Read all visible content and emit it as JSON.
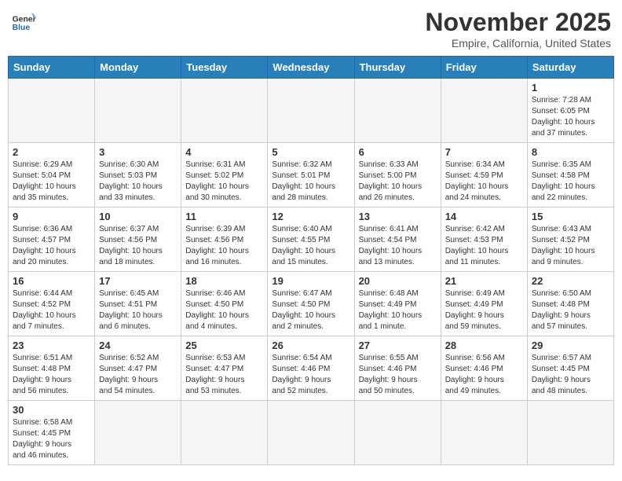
{
  "header": {
    "logo_general": "General",
    "logo_blue": "Blue",
    "month": "November 2025",
    "location": "Empire, California, United States"
  },
  "weekdays": [
    "Sunday",
    "Monday",
    "Tuesday",
    "Wednesday",
    "Thursday",
    "Friday",
    "Saturday"
  ],
  "weeks": [
    [
      {
        "day": "",
        "info": ""
      },
      {
        "day": "",
        "info": ""
      },
      {
        "day": "",
        "info": ""
      },
      {
        "day": "",
        "info": ""
      },
      {
        "day": "",
        "info": ""
      },
      {
        "day": "",
        "info": ""
      },
      {
        "day": "1",
        "info": "Sunrise: 7:28 AM\nSunset: 6:05 PM\nDaylight: 10 hours\nand 37 minutes."
      }
    ],
    [
      {
        "day": "2",
        "info": "Sunrise: 6:29 AM\nSunset: 5:04 PM\nDaylight: 10 hours\nand 35 minutes."
      },
      {
        "day": "3",
        "info": "Sunrise: 6:30 AM\nSunset: 5:03 PM\nDaylight: 10 hours\nand 33 minutes."
      },
      {
        "day": "4",
        "info": "Sunrise: 6:31 AM\nSunset: 5:02 PM\nDaylight: 10 hours\nand 30 minutes."
      },
      {
        "day": "5",
        "info": "Sunrise: 6:32 AM\nSunset: 5:01 PM\nDaylight: 10 hours\nand 28 minutes."
      },
      {
        "day": "6",
        "info": "Sunrise: 6:33 AM\nSunset: 5:00 PM\nDaylight: 10 hours\nand 26 minutes."
      },
      {
        "day": "7",
        "info": "Sunrise: 6:34 AM\nSunset: 4:59 PM\nDaylight: 10 hours\nand 24 minutes."
      },
      {
        "day": "8",
        "info": "Sunrise: 6:35 AM\nSunset: 4:58 PM\nDaylight: 10 hours\nand 22 minutes."
      }
    ],
    [
      {
        "day": "9",
        "info": "Sunrise: 6:36 AM\nSunset: 4:57 PM\nDaylight: 10 hours\nand 20 minutes."
      },
      {
        "day": "10",
        "info": "Sunrise: 6:37 AM\nSunset: 4:56 PM\nDaylight: 10 hours\nand 18 minutes."
      },
      {
        "day": "11",
        "info": "Sunrise: 6:39 AM\nSunset: 4:56 PM\nDaylight: 10 hours\nand 16 minutes."
      },
      {
        "day": "12",
        "info": "Sunrise: 6:40 AM\nSunset: 4:55 PM\nDaylight: 10 hours\nand 15 minutes."
      },
      {
        "day": "13",
        "info": "Sunrise: 6:41 AM\nSunset: 4:54 PM\nDaylight: 10 hours\nand 13 minutes."
      },
      {
        "day": "14",
        "info": "Sunrise: 6:42 AM\nSunset: 4:53 PM\nDaylight: 10 hours\nand 11 minutes."
      },
      {
        "day": "15",
        "info": "Sunrise: 6:43 AM\nSunset: 4:52 PM\nDaylight: 10 hours\nand 9 minutes."
      }
    ],
    [
      {
        "day": "16",
        "info": "Sunrise: 6:44 AM\nSunset: 4:52 PM\nDaylight: 10 hours\nand 7 minutes."
      },
      {
        "day": "17",
        "info": "Sunrise: 6:45 AM\nSunset: 4:51 PM\nDaylight: 10 hours\nand 6 minutes."
      },
      {
        "day": "18",
        "info": "Sunrise: 6:46 AM\nSunset: 4:50 PM\nDaylight: 10 hours\nand 4 minutes."
      },
      {
        "day": "19",
        "info": "Sunrise: 6:47 AM\nSunset: 4:50 PM\nDaylight: 10 hours\nand 2 minutes."
      },
      {
        "day": "20",
        "info": "Sunrise: 6:48 AM\nSunset: 4:49 PM\nDaylight: 10 hours\nand 1 minute."
      },
      {
        "day": "21",
        "info": "Sunrise: 6:49 AM\nSunset: 4:49 PM\nDaylight: 9 hours\nand 59 minutes."
      },
      {
        "day": "22",
        "info": "Sunrise: 6:50 AM\nSunset: 4:48 PM\nDaylight: 9 hours\nand 57 minutes."
      }
    ],
    [
      {
        "day": "23",
        "info": "Sunrise: 6:51 AM\nSunset: 4:48 PM\nDaylight: 9 hours\nand 56 minutes."
      },
      {
        "day": "24",
        "info": "Sunrise: 6:52 AM\nSunset: 4:47 PM\nDaylight: 9 hours\nand 54 minutes."
      },
      {
        "day": "25",
        "info": "Sunrise: 6:53 AM\nSunset: 4:47 PM\nDaylight: 9 hours\nand 53 minutes."
      },
      {
        "day": "26",
        "info": "Sunrise: 6:54 AM\nSunset: 4:46 PM\nDaylight: 9 hours\nand 52 minutes."
      },
      {
        "day": "27",
        "info": "Sunrise: 6:55 AM\nSunset: 4:46 PM\nDaylight: 9 hours\nand 50 minutes."
      },
      {
        "day": "28",
        "info": "Sunrise: 6:56 AM\nSunset: 4:46 PM\nDaylight: 9 hours\nand 49 minutes."
      },
      {
        "day": "29",
        "info": "Sunrise: 6:57 AM\nSunset: 4:45 PM\nDaylight: 9 hours\nand 48 minutes."
      }
    ],
    [
      {
        "day": "30",
        "info": "Sunrise: 6:58 AM\nSunset: 4:45 PM\nDaylight: 9 hours\nand 46 minutes."
      },
      {
        "day": "",
        "info": ""
      },
      {
        "day": "",
        "info": ""
      },
      {
        "day": "",
        "info": ""
      },
      {
        "day": "",
        "info": ""
      },
      {
        "day": "",
        "info": ""
      },
      {
        "day": "",
        "info": ""
      }
    ]
  ]
}
